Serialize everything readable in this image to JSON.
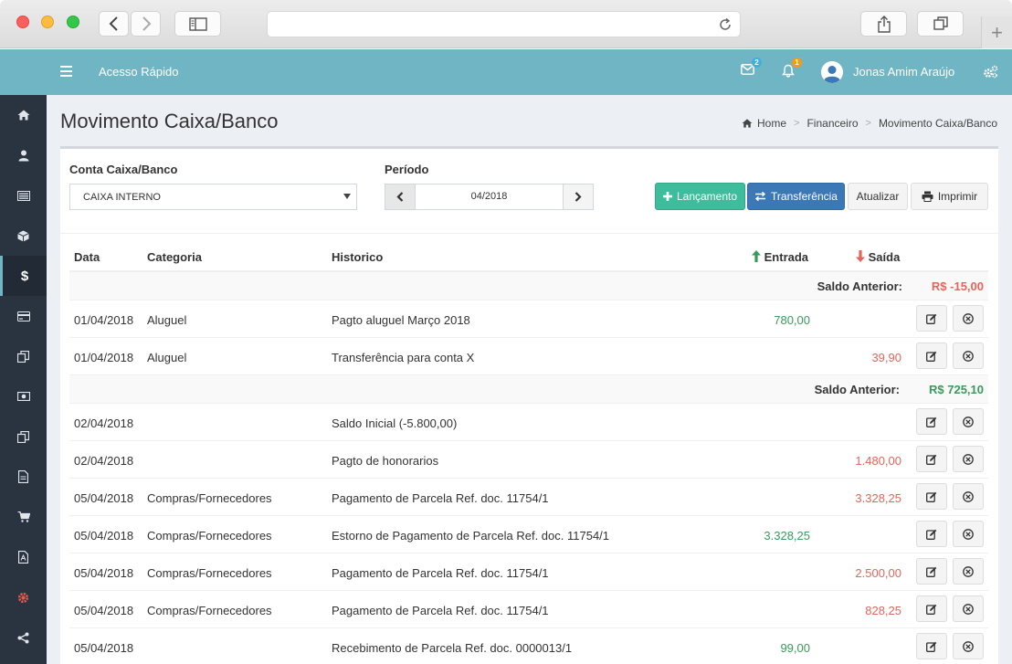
{
  "topbar": {
    "quick_access": "Acesso Rápido",
    "mail_badge": "2",
    "bell_badge": "1",
    "user_name": "Jonas Amim Araújo",
    "color": "#6fb5c4"
  },
  "sidebar": {
    "items": [
      "home-icon",
      "user-icon",
      "list-icon",
      "cube-icon",
      "dollar-icon",
      "credit-card-icon",
      "clipboard-icon",
      "money-icon",
      "clipboard-icon",
      "document-icon",
      "cart-icon",
      "pdf-icon",
      "gear-icon",
      "share-icon"
    ],
    "dollar_symbol": "$"
  },
  "page": {
    "title": "Movimento Caixa/Banco",
    "breadcrumb": [
      "Home",
      "Financeiro",
      "Movimento Caixa/Banco"
    ]
  },
  "filters": {
    "account_label": "Conta Caixa/Banco",
    "account_value": "CAIXA INTERNO",
    "period_label": "Período",
    "period_value": "04/2018"
  },
  "actions": {
    "launch": "Lançamento",
    "transfer": "Transferência",
    "refresh": "Atualizar",
    "print": "Imprimir"
  },
  "table": {
    "headers": {
      "date": "Data",
      "category": "Categoria",
      "history": "Historico",
      "in": "Entrada",
      "out": "Saída"
    },
    "saldo_label": "Saldo Anterior:",
    "saldos": [
      {
        "value": "R$ -15,00",
        "color": "#e5655a"
      },
      {
        "value": "R$ 725,10",
        "color": "#3a9a5b"
      }
    ],
    "rows": [
      {
        "date": "01/04/2018",
        "category": "Aluguel",
        "history": "Pagto aluguel Março 2018",
        "in": "780,00",
        "out": ""
      },
      {
        "date": "01/04/2018",
        "category": "Aluguel",
        "history": "Transferência para conta X",
        "in": "",
        "out": "39,90"
      },
      {
        "date": "02/04/2018",
        "category": "",
        "history": "Saldo Inicial (-5.800,00)",
        "in": "",
        "out": ""
      },
      {
        "date": "02/04/2018",
        "category": "",
        "history": "Pagto de honorarios",
        "in": "",
        "out": "1.480,00"
      },
      {
        "date": "05/04/2018",
        "category": "Compras/Fornecedores",
        "history": "Pagamento de Parcela Ref. doc. 11754/1",
        "in": "",
        "out": "3.328,25"
      },
      {
        "date": "05/04/2018",
        "category": "Compras/Fornecedores",
        "history": "Estorno de Pagamento de Parcela Ref. doc. 11754/1",
        "in": "3.328,25",
        "out": ""
      },
      {
        "date": "05/04/2018",
        "category": "Compras/Fornecedores",
        "history": "Pagamento de Parcela Ref. doc. 11754/1",
        "in": "",
        "out": "2.500,00"
      },
      {
        "date": "05/04/2018",
        "category": "Compras/Fornecedores",
        "history": "Pagamento de Parcela Ref. doc. 11754/1",
        "in": "",
        "out": "828,25"
      },
      {
        "date": "05/04/2018",
        "category": "",
        "history": "Recebimento de Parcela Ref. doc. 0000013/1",
        "in": "99,00",
        "out": ""
      }
    ]
  }
}
